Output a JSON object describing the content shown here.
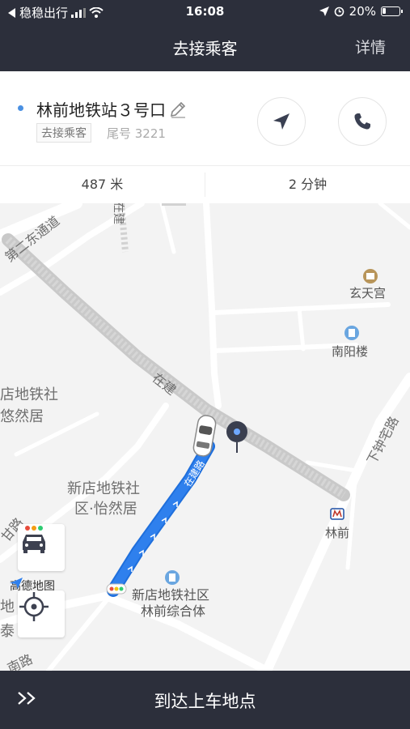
{
  "status_bar": {
    "back_app": "稳稳出行",
    "time": "16:08",
    "battery": "20%"
  },
  "header": {
    "title": "去接乘客",
    "detail": "详情"
  },
  "trip": {
    "destination": "林前地铁站３号口",
    "status_tag": "去接乘客",
    "tail_number": "尾号 3221",
    "distance": "487 米",
    "duration": "2 分钟"
  },
  "map": {
    "labels": {
      "road_2nd_east": "第二东通道",
      "road_zaijian": "在建",
      "road_zaijian_top": "在建",
      "road_xiazhongzhai": "下钟宅路",
      "road_nan": "南路",
      "road_ganlu": "甘路",
      "road_jian_small": "在建路",
      "area_xindian_left": "店地铁社",
      "area_youranju": "悠然居",
      "area_xindian_mid": "新店地铁社",
      "area_yiranju": "区·怡然居",
      "area_xindian_bottom": "新店地铁社区",
      "area_linqian_complex": "林前综合体",
      "poi_xuantiangong": "玄天宫",
      "poi_nanyanglou": "南阳楼",
      "poi_linqian": "林前",
      "edge_di": "地",
      "edge_tai": "泰",
      "amap": "高德地图"
    },
    "colors": {
      "route": "#2f80ed",
      "road_planned": "#c9c9c9"
    }
  },
  "bottom": {
    "action_label": "到达上车地点"
  }
}
